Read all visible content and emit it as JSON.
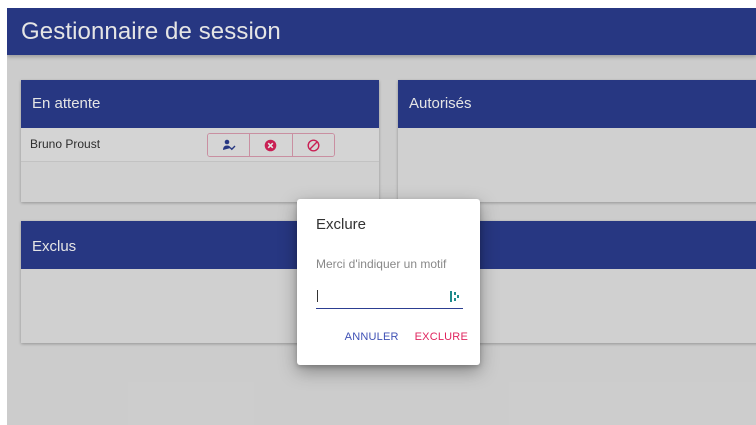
{
  "app": {
    "title": "Gestionnaire de session"
  },
  "panels": {
    "pending": {
      "title": "En attente",
      "users": [
        {
          "name": "Bruno Proust"
        }
      ]
    },
    "authorized": {
      "title": "Autorisés"
    },
    "excluded": {
      "title": "Exclus"
    }
  },
  "actions": {
    "icons": [
      "user-check-icon",
      "cancel-circle-icon",
      "block-icon"
    ]
  },
  "dialog": {
    "title": "Exclure",
    "message": "Merci d'indiquer un motif",
    "input_value": "",
    "cancel_label": "ANNULER",
    "confirm_label": "EXCLURE"
  },
  "colors": {
    "primary": "#2c3e91",
    "accent": "#e0245e",
    "link": "#3f51b5"
  }
}
